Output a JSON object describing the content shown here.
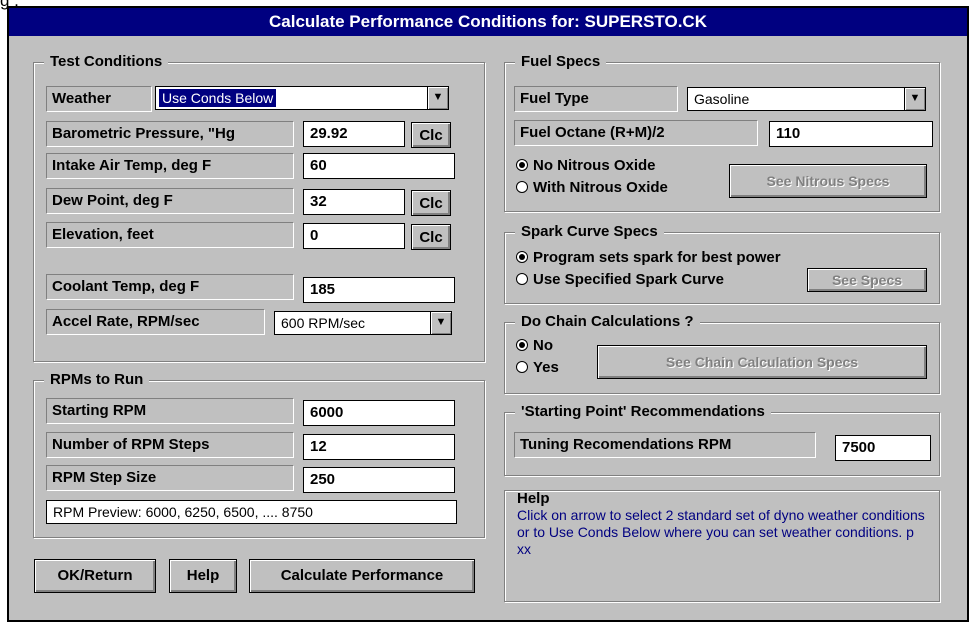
{
  "background_fragment": "g ,",
  "title": "Calculate Performance Conditions for: SUPERSTO.CK",
  "test_conditions": {
    "title": "Test Conditions",
    "weather": {
      "label": "Weather",
      "value": "Use Conds Below"
    },
    "barometric": {
      "label": "Barometric Pressure, \"Hg",
      "value": "29.92",
      "button": "Clc"
    },
    "intake_air": {
      "label": "Intake Air Temp, deg F",
      "value": "60"
    },
    "dew_point": {
      "label": "Dew Point, deg F",
      "value": "32",
      "button": "Clc"
    },
    "elevation": {
      "label": "Elevation, feet",
      "value": "0",
      "button": "Clc"
    },
    "coolant": {
      "label": "Coolant Temp, deg F",
      "value": "185"
    },
    "accel": {
      "label": "Accel Rate, RPM/sec",
      "value": "600 RPM/sec"
    }
  },
  "rpms": {
    "title": "RPMs to Run",
    "starting": {
      "label": "Starting RPM",
      "value": "6000"
    },
    "steps": {
      "label": "Number of RPM Steps",
      "value": "12"
    },
    "step_size": {
      "label": "RPM Step Size",
      "value": "250"
    },
    "preview": "RPM Preview: 6000, 6250, 6500, .... 8750"
  },
  "buttons": {
    "ok": "OK/Return",
    "help": "Help",
    "calc": "Calculate Performance"
  },
  "fuel": {
    "title": "Fuel Specs",
    "type_label": "Fuel Type",
    "type_value": "Gasoline",
    "octane_label": "Fuel Octane (R+M)/2",
    "octane_value": "110",
    "no_nitrous": "No Nitrous Oxide",
    "with_nitrous": "With Nitrous Oxide",
    "nitrous_button": "See Nitrous Specs"
  },
  "spark": {
    "title": "Spark Curve Specs",
    "opt1": "Program sets spark for best power",
    "opt2": "Use Specified Spark Curve",
    "button": "See Specs"
  },
  "chain": {
    "title": "Do Chain Calculations ?",
    "no": "No",
    "yes": "Yes",
    "button": "See Chain Calculation Specs"
  },
  "recommend": {
    "title": "'Starting Point' Recommendations",
    "label": "Tuning Recomendations RPM",
    "value": "7500"
  },
  "help": {
    "title": "Help",
    "text": "Click on arrow to select 2 standard set of dyno weather conditions or to Use Conds Below where you can set weather conditions.  p xx"
  },
  "icons": {
    "dropdown": "dropdown-arrow-icon",
    "radio": "radio-icon"
  },
  "colors": {
    "titlebar": "#000080",
    "dialog": "#c0c0c0",
    "help_text": "#000080"
  }
}
